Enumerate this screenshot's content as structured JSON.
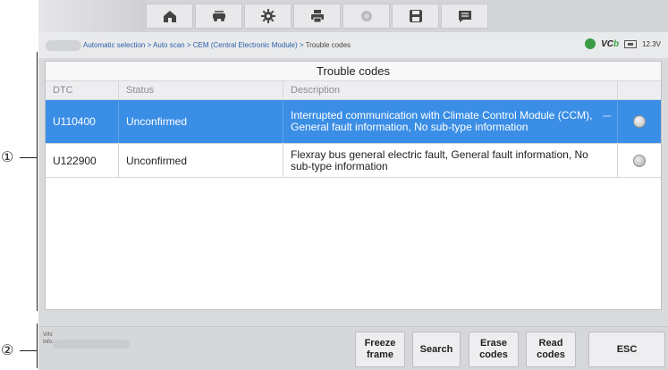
{
  "callouts": {
    "one": "①",
    "two": "②"
  },
  "nav": {
    "icons": [
      "home-icon",
      "vehicle-swap-icon",
      "settings-icon",
      "print-icon",
      "help-icon",
      "save-icon",
      "message-icon"
    ]
  },
  "breadcrumb": {
    "path": "Automatic selection > Auto scan > CEM (Central Electronic Module) > ",
    "current": "Trouble codes"
  },
  "status": {
    "vcb_prefix": "VC",
    "vcb_suffix": "b",
    "voltage": "12.3V"
  },
  "panel": {
    "title": "Trouble codes",
    "columns": {
      "dtc": "DTC",
      "status": "Status",
      "description": "Description"
    },
    "rows": [
      {
        "dtc": "U110400",
        "status": "Unconfirmed",
        "description": "Interrupted communication with Climate Control Module (CCM), General fault information, No sub-type information",
        "selected": true
      },
      {
        "dtc": "U122900",
        "status": "Unconfirmed",
        "description": "Flexray bus general electric fault, General fault information, No sub-type information",
        "selected": false
      }
    ]
  },
  "footer": {
    "vin_label": "VIN:",
    "info_label": "Info:",
    "buttons": {
      "freeze": "Freeze frame",
      "search": "Search",
      "erase": "Erase codes",
      "read": "Read codes",
      "esc": "ESC"
    }
  },
  "colors": {
    "selected_row": "#3a8ee6",
    "link": "#2a5fa8",
    "vcb_accent": "#3aa443"
  }
}
